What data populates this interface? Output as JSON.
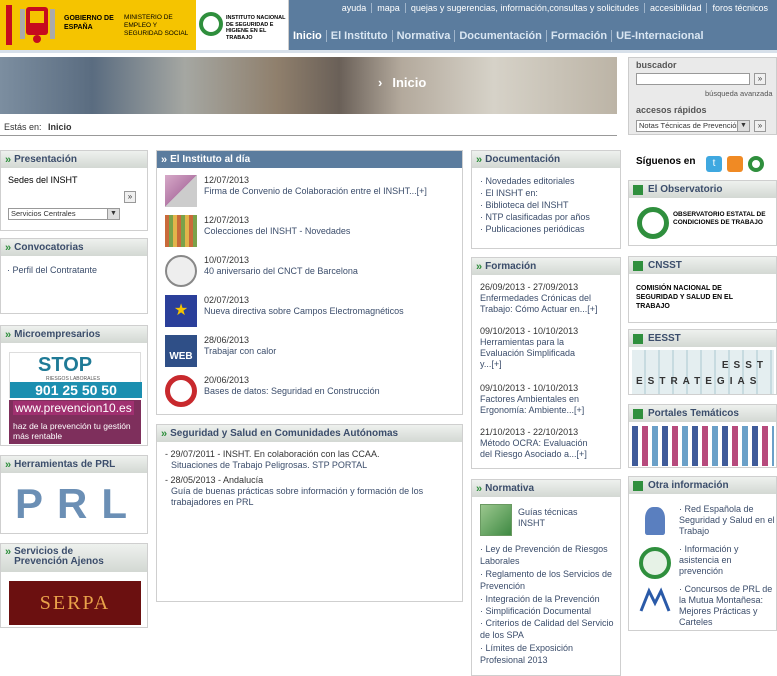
{
  "header": {
    "gov_text": "GOBIERNO DE ESPAÑA",
    "ministry_text": "MINISTERIO DE EMPLEO Y SEGURIDAD SOCIAL",
    "insht_text": "INSTITUTO NACIONAL DE SEGURIDAD E HIGIENE EN EL TRABAJO",
    "top_links": [
      "ayuda",
      "mapa",
      "quejas y sugerencias, información,consultas y solicitudes",
      "accesibilidad",
      "foros técnicos"
    ],
    "nav": [
      "Inicio",
      "El Instituto",
      "Normativa",
      "Documentación",
      "Formación",
      "UE-Internacional"
    ]
  },
  "banner": {
    "title": "Inicio"
  },
  "search": {
    "label": "buscador",
    "go": "»",
    "advanced": "búsqueda avanzada",
    "quick_label": "accesos rápidos",
    "quick_value": "Notas Técnicas de Prevención"
  },
  "breadcrumb": {
    "prefix": "Estás en:",
    "current": "Inicio"
  },
  "left": {
    "presentacion": {
      "title": "Presentación",
      "sedes": "Sedes del INSHT",
      "select": "Servicios Centrales"
    },
    "convocatorias": {
      "title": "Convocatorias",
      "item": "Perfil del Contratante"
    },
    "micro": {
      "title": "Microempresarios",
      "stop_title": "STOP",
      "stop_sub": "RIESGOS LABORALES",
      "stop_phone": "901 25 50 50",
      "prev_url": "www.prevencion10.es",
      "prev_text": "haz de la prevención tu gestión más rentable"
    },
    "herramientas": {
      "title": "Herramientas de PRL",
      "logo": "PRL"
    },
    "servicios": {
      "title": "Servicios de Prevención Ajenos",
      "logo": "SERPA"
    }
  },
  "center": {
    "instituto": {
      "title": "El Instituto al día",
      "news": [
        {
          "date": "12/07/2013",
          "text": "Firma de Convenio de Colaboración entre el INSHT...[+]"
        },
        {
          "date": "12/07/2013",
          "text": "Colecciones del INSHT - Novedades"
        },
        {
          "date": "10/07/2013",
          "text": "40 aniversario del CNCT de Barcelona"
        },
        {
          "date": "02/07/2013",
          "text": "Nueva directiva sobre Campos Electromagnéticos"
        },
        {
          "date": "28/06/2013",
          "text": "Trabajar con calor"
        },
        {
          "date": "20/06/2013",
          "text": "Bases de datos: Seguridad en Construcción"
        }
      ]
    },
    "ccaa": {
      "title": "Seguridad y Salud en Comunidades Autónomas",
      "items": [
        {
          "head": "29/07/2011 - INSHT. En colaboración con las CCAA.",
          "text": "Situaciones de Trabajo Peligrosas. STP PORTAL"
        },
        {
          "head": "28/05/2013 - Andalucía",
          "text": "Guía de buenas prácticas sobre información y formación de los trabajadores en PRL"
        }
      ]
    }
  },
  "right1": {
    "documentacion": {
      "title": "Documentación",
      "items": [
        "Novedades editoriales",
        "El INSHT en:",
        "Biblioteca del INSHT",
        "NTP clasificadas por años",
        "Publicaciones periódicas"
      ]
    },
    "formacion": {
      "title": "Formación",
      "items": [
        {
          "date": "26/09/2013 - 27/09/2013",
          "l1": "Enfermedades Crónicas del",
          "l2": "Trabajo: Cómo Actuar en...[+]",
          "l3": ""
        },
        {
          "date": "09/10/2013 - 10/10/2013",
          "l1": "Herramientas para la",
          "l2": "Evaluación Simplificada",
          "l3": "y...[+]"
        },
        {
          "date": "09/10/2013 - 10/10/2013",
          "l1": "Factores Ambientales en",
          "l2": "Ergonomía: Ambiente...[+]",
          "l3": ""
        },
        {
          "date": "21/10/2013 - 22/10/2013",
          "l1": "Método OCRA: Evaluación",
          "l2": "del Riesgo Asociado a...[+]",
          "l3": ""
        }
      ]
    },
    "normativa": {
      "title": "Normativa",
      "guias": "Guías técnicas INSHT",
      "items": [
        "Ley de Prevención de Riesgos Laborales",
        "Reglamento de los Servicios de Prevención",
        "Integración de la Prevención",
        "Simplificación Documental",
        "Criterios de Calidad del Servicio de los SPA",
        "Límites de Exposición Profesional 2013"
      ]
    }
  },
  "right2": {
    "siguenos": "Síguenos en",
    "observatorio": {
      "title": "El Observatorio",
      "logo_text": "OBSERVATORIO ESTATAL DE CONDICIONES DE TRABAJO"
    },
    "cnsst": {
      "title": "CNSST",
      "text": "COMISIÓN NACIONAL DE SEGURIDAD Y SALUD EN EL TRABAJO"
    },
    "eesst": {
      "title": "EESST",
      "l1": "ESST",
      "l2": "ESTRATEGIAS"
    },
    "portales": {
      "title": "Portales Temáticos"
    },
    "otra": {
      "title": "Otra información",
      "items": [
        "Red Española de Seguridad y Salud en el Trabajo",
        "Información y asistencia en prevención",
        "Concursos de PRL de la Mutua Montañesa: Mejores Prácticas y Carteles"
      ]
    }
  }
}
